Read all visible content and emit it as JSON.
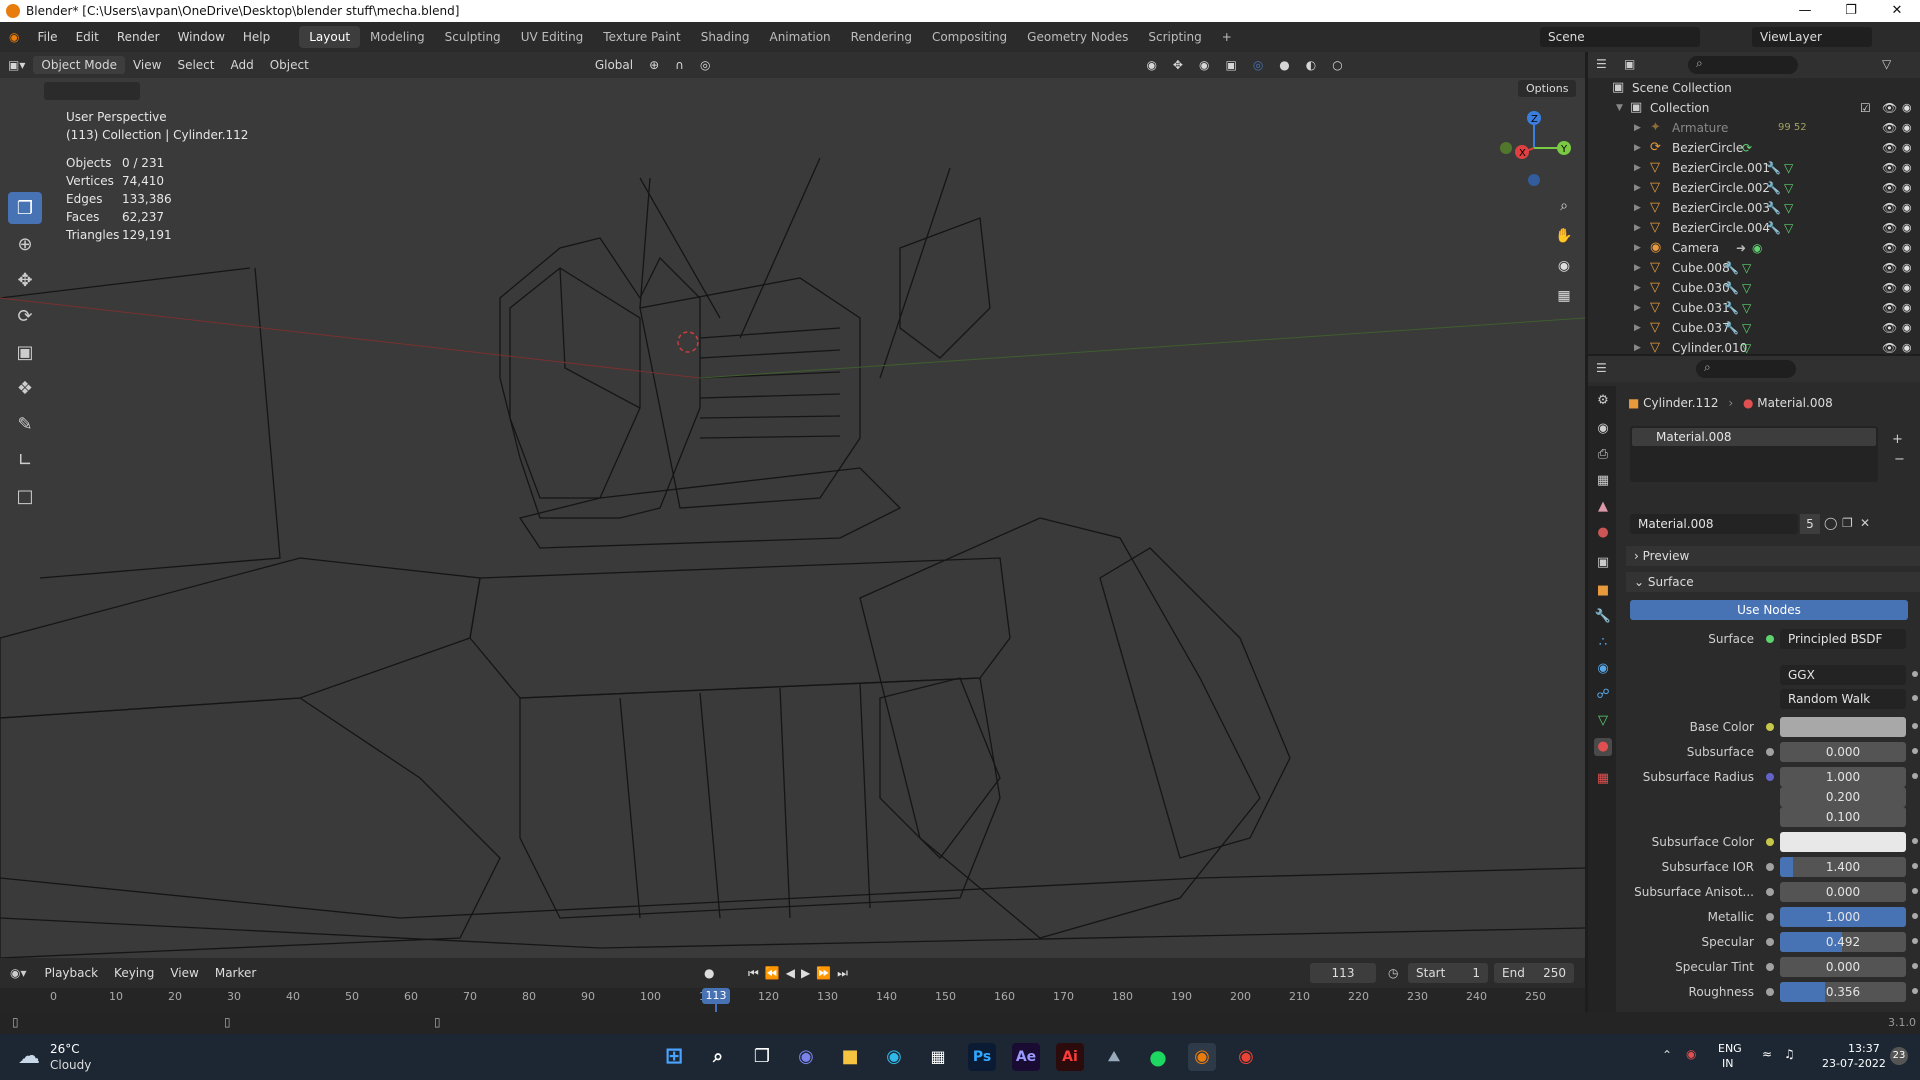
{
  "window": {
    "title": "Blender* [C:\\Users\\avpan\\OneDrive\\Desktop\\blender stuff\\mecha.blend]"
  },
  "menu": [
    "File",
    "Edit",
    "Render",
    "Window",
    "Help"
  ],
  "workspaces": [
    "Layout",
    "Modeling",
    "Sculpting",
    "UV Editing",
    "Texture Paint",
    "Shading",
    "Animation",
    "Rendering",
    "Compositing",
    "Geometry Nodes",
    "Scripting"
  ],
  "scene": "Scene",
  "view_layer": "ViewLayer",
  "viewport_header": {
    "mode": "Object Mode",
    "items": [
      "View",
      "Select",
      "Add",
      "Object"
    ],
    "orientation": "Global",
    "options": "Options"
  },
  "overlay": {
    "view_name": "User Perspective",
    "collection_line": "(113) Collection | Cylinder.112"
  },
  "stats": [
    {
      "label": "Objects",
      "value": "0 / 231"
    },
    {
      "label": "Vertices",
      "value": "74,410"
    },
    {
      "label": "Edges",
      "value": "133,386"
    },
    {
      "label": "Faces",
      "value": "62,237"
    },
    {
      "label": "Triangles",
      "value": "129,191"
    }
  ],
  "outliner": {
    "scene_collection": "Scene Collection",
    "collection": "Collection",
    "items": [
      {
        "name": "Armature",
        "extra": "99  52"
      },
      {
        "name": "BezierCircle"
      },
      {
        "name": "BezierCircle.001"
      },
      {
        "name": "BezierCircle.002"
      },
      {
        "name": "BezierCircle.003"
      },
      {
        "name": "BezierCircle.004"
      },
      {
        "name": "Camera"
      },
      {
        "name": "Cube.008"
      },
      {
        "name": "Cube.030"
      },
      {
        "name": "Cube.031"
      },
      {
        "name": "Cube.037"
      },
      {
        "name": "Cylinder.010"
      }
    ]
  },
  "properties": {
    "breadcrumb_object": "Cylinder.112",
    "breadcrumb_material": "Material.008",
    "slot": "Material.008",
    "material_name": "Material.008",
    "users": "5",
    "preview": "Preview",
    "surface_panel": "Surface",
    "use_nodes": "Use Nodes",
    "surface_label": "Surface",
    "surface_value": "Principled BSDF",
    "distribution": "GGX",
    "subsurface_method": "Random Walk",
    "rows": [
      {
        "label": "Base Color",
        "value": "",
        "type": "color",
        "color": "#a8a8a8"
      },
      {
        "label": "Subsurface",
        "value": "0.000",
        "fraction": 0
      },
      {
        "label": "Subsurface Radius",
        "value": "1.000",
        "fraction": 0
      },
      {
        "label": "",
        "value": "0.200",
        "fraction": 0
      },
      {
        "label": "",
        "value": "0.100",
        "fraction": 0
      },
      {
        "label": "Subsurface Color",
        "value": "",
        "type": "color",
        "color": "#e8e8e8"
      },
      {
        "label": "Subsurface IOR",
        "value": "1.400",
        "fraction": 0.1
      },
      {
        "label": "Subsurface Anisot...",
        "value": "0.000",
        "fraction": 0
      },
      {
        "label": "Metallic",
        "value": "1.000",
        "fraction": 1
      },
      {
        "label": "Specular",
        "value": "0.492",
        "fraction": 0.492
      },
      {
        "label": "Specular Tint",
        "value": "0.000",
        "fraction": 0
      },
      {
        "label": "Roughness",
        "value": "0.356",
        "fraction": 0.356
      }
    ]
  },
  "timeline": {
    "menus": [
      "Playback",
      "Keying",
      "View",
      "Marker"
    ],
    "current_frame": "113",
    "start_label": "Start",
    "start": "1",
    "end_label": "End",
    "end": "250",
    "ticks": [
      "0",
      "10",
      "20",
      "30",
      "40",
      "50",
      "60",
      "70",
      "80",
      "90",
      "100",
      "110",
      "120",
      "130",
      "140",
      "150",
      "160",
      "170",
      "180",
      "190",
      "200",
      "210",
      "220",
      "230",
      "240",
      "250"
    ]
  },
  "version": "3.1.0",
  "taskbar": {
    "weather_temp": "26°C",
    "weather_desc": "Cloudy",
    "lang": "ENG",
    "region": "IN",
    "time": "13:37",
    "date": "23-07-2022",
    "notif": "23"
  }
}
